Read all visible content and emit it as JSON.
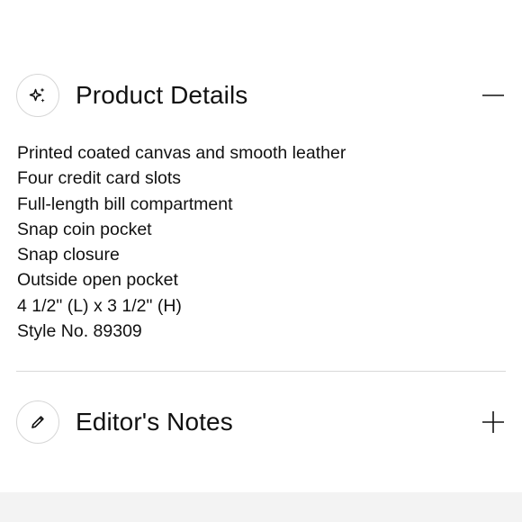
{
  "product_details": {
    "title": "Product Details",
    "icon": "sparkle-icon",
    "toggle_icon": "minus-icon",
    "items": [
      "Printed coated canvas and smooth leather",
      "Four credit card slots",
      "Full-length bill compartment",
      "Snap coin pocket",
      "Snap closure",
      "Outside open pocket",
      "4 1/2\" (L) x 3 1/2\" (H)",
      "Style No. 89309"
    ]
  },
  "editors_notes": {
    "title": "Editor's Notes",
    "icon": "pencil-icon",
    "toggle_icon": "plus-icon"
  },
  "colors": {
    "text": "#111111",
    "border": "#d6d6d6",
    "divider": "#d9d9d9",
    "footer_band": "#f3f3f3"
  }
}
